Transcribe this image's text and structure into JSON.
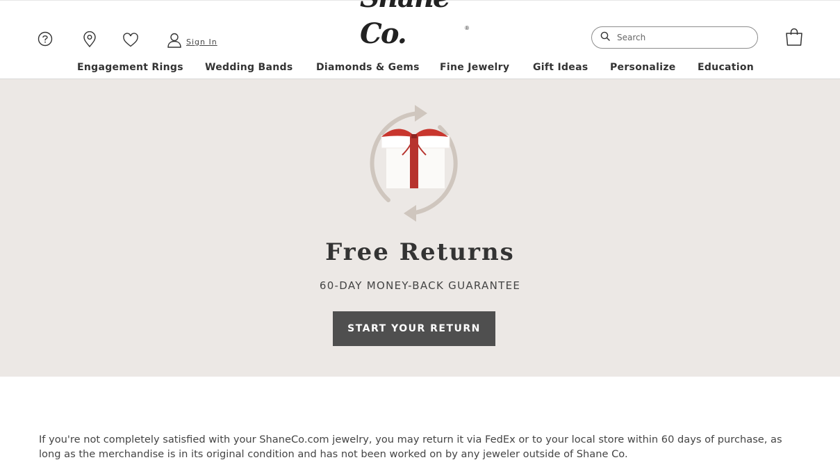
{
  "header": {
    "icons": {
      "help": "help-circle-icon",
      "store": "location-pin-icon",
      "wishlist": "heart-icon",
      "account": "user-icon",
      "search": "search-icon",
      "cart": "shopping-bag-icon"
    },
    "sign_in_label": "Sign In",
    "logo_text": "Shane Co.",
    "logo_mark": "®",
    "search_placeholder": "Search"
  },
  "nav": {
    "items": [
      {
        "label": "Engagement Rings"
      },
      {
        "label": "Wedding Bands"
      },
      {
        "label": "Diamonds & Gems"
      },
      {
        "label": "Fine Jewelry"
      },
      {
        "label": "Gift Ideas"
      },
      {
        "label": "Personalize"
      },
      {
        "label": "Education"
      }
    ]
  },
  "hero": {
    "icon": "gift-return-cycle-icon",
    "title": "Free Returns",
    "subtitle": "60-DAY MONEY-BACK GUARANTEE",
    "button_label": "START YOUR RETURN",
    "colors": {
      "background": "#ece8e5",
      "button": "#4f4f4f",
      "ribbon": "#b7342f",
      "arrows": "#cfc6be"
    }
  },
  "body": {
    "paragraph": "If you're not completely satisfied with your ShaneCo.com jewelry, you may return it via FedEx or to your local store within 60 days of purchase, as long as the merchandise is in its original condition and has not been worked on by any jeweler outside of Shane Co."
  }
}
